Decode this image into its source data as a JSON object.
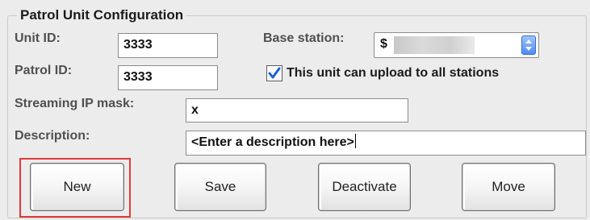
{
  "group": {
    "title": "Patrol Unit Configuration"
  },
  "fields": {
    "unit_id": {
      "label": "Unit ID:",
      "value": "3333"
    },
    "patrol_id": {
      "label": "Patrol ID:",
      "value": "3333"
    },
    "base_station": {
      "label": "Base station:",
      "value": "$"
    },
    "upload_all": {
      "label": "This unit can upload to all stations",
      "checked": true
    },
    "streaming_ip_mask": {
      "label": "Streaming IP mask:",
      "value": "x"
    },
    "description": {
      "label": "Description:",
      "value": "<Enter a description here>"
    }
  },
  "buttons": {
    "new": "New",
    "save": "Save",
    "deactivate": "Deactivate",
    "move": "Move"
  },
  "colors": {
    "highlight": "#e13b3b",
    "check": "#1f5fd6"
  }
}
